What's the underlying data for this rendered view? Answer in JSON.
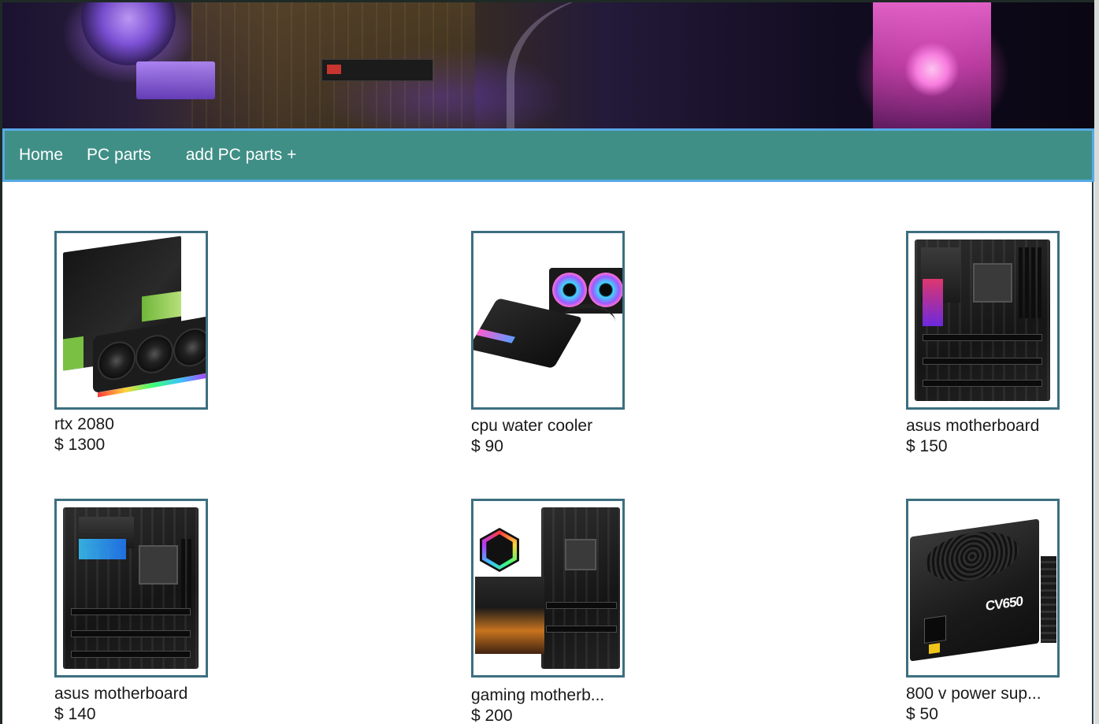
{
  "nav": {
    "home": "Home",
    "pc_parts": "PC parts",
    "add_pc_parts": "add PC parts +"
  },
  "products": [
    {
      "name": "rtx 2080",
      "price": "$ 1300",
      "image": "graphics-card"
    },
    {
      "name": "cpu water cooler",
      "price": "$ 90",
      "image": "water-cooler"
    },
    {
      "name": "asus motherboard",
      "price": "$ 150",
      "image": "motherboard"
    },
    {
      "name": "asus motherboard",
      "price": "$ 140",
      "image": "motherboard"
    },
    {
      "name": "gaming motherb...",
      "price": "$ 200",
      "image": "motherboard-box"
    },
    {
      "name": "800 v power sup...",
      "price": "$ 50",
      "image": "power-supply"
    }
  ],
  "psu_label": "CV650",
  "colors": {
    "nav_bg": "#3f8f86",
    "nav_border": "#58a9e6",
    "thumb_border": "#3d6f80"
  }
}
